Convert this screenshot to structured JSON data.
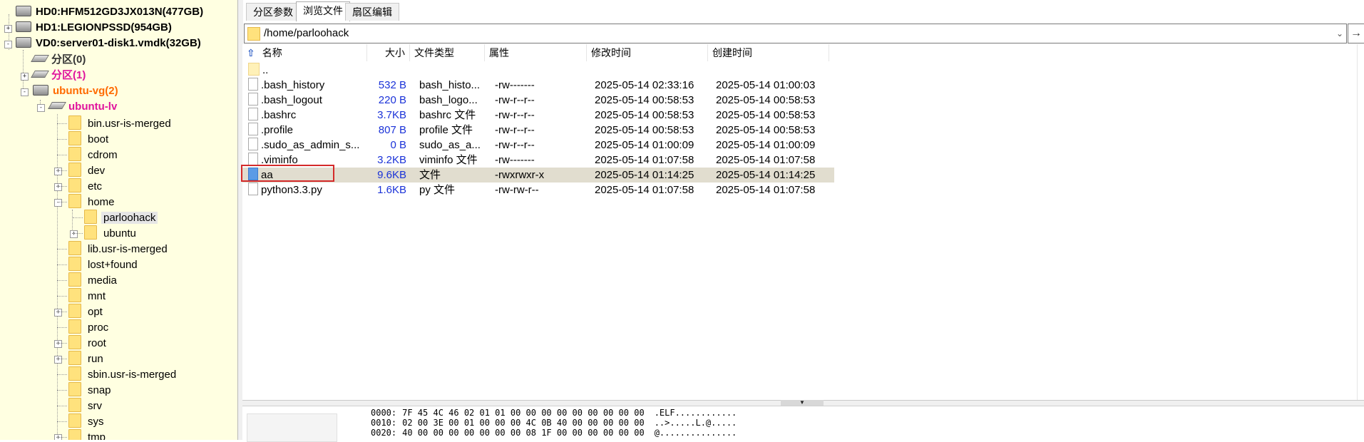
{
  "tree": {
    "disks": [
      {
        "label": "HD0:HFM512GD3JX013N(477GB)"
      },
      {
        "label": "HD1:LEGIONPSSD(954GB)"
      },
      {
        "label": "VD0:server01-disk1.vmdk(32GB)"
      }
    ],
    "partitions": [
      {
        "label": "分区(0)"
      },
      {
        "label": "分区(1)"
      },
      {
        "label": "ubuntu-vg(2)"
      }
    ],
    "lv": {
      "label": "ubuntu-lv"
    },
    "folders": [
      {
        "label": "bin.usr-is-merged",
        "expander": ""
      },
      {
        "label": "boot",
        "expander": ""
      },
      {
        "label": "cdrom",
        "expander": ""
      },
      {
        "label": "dev",
        "expander": "+"
      },
      {
        "label": "etc",
        "expander": "+"
      },
      {
        "label": "home",
        "expander": "-"
      },
      {
        "label": "parloohack",
        "expander": ""
      },
      {
        "label": "ubuntu",
        "expander": "+"
      },
      {
        "label": "lib.usr-is-merged",
        "expander": ""
      },
      {
        "label": "lost+found",
        "expander": ""
      },
      {
        "label": "media",
        "expander": ""
      },
      {
        "label": "mnt",
        "expander": ""
      },
      {
        "label": "opt",
        "expander": "+"
      },
      {
        "label": "proc",
        "expander": ""
      },
      {
        "label": "root",
        "expander": "+"
      },
      {
        "label": "run",
        "expander": "+"
      },
      {
        "label": "sbin.usr-is-merged",
        "expander": ""
      },
      {
        "label": "snap",
        "expander": ""
      },
      {
        "label": "srv",
        "expander": ""
      },
      {
        "label": "sys",
        "expander": ""
      },
      {
        "label": "tmp",
        "expander": "+"
      }
    ]
  },
  "tabs": [
    {
      "label": "分区参数"
    },
    {
      "label": "浏览文件"
    },
    {
      "label": "扇区编辑"
    }
  ],
  "path": {
    "value": "/home/parloohack",
    "go_glyph": "→",
    "drop_glyph": "⌄"
  },
  "columns": {
    "name": "名称",
    "size": "大小",
    "type": "文件类型",
    "attr": "属性",
    "modified": "修改时间",
    "created": "创建时间",
    "up_glyph": "⇧"
  },
  "files": [
    {
      "name": "..",
      "size": "",
      "type": "",
      "attr": "",
      "modified": "",
      "created": ""
    },
    {
      "name": ".bash_history",
      "size": "532 B",
      "type": "bash_histo...",
      "attr": "-rw-------",
      "modified": "2025-05-14 02:33:16",
      "created": "2025-05-14 01:00:03"
    },
    {
      "name": ".bash_logout",
      "size": "220 B",
      "type": "bash_logo...",
      "attr": "-rw-r--r--",
      "modified": "2025-05-14 00:58:53",
      "created": "2025-05-14 00:58:53"
    },
    {
      "name": ".bashrc",
      "size": "3.7KB",
      "type": "bashrc 文件",
      "attr": "-rw-r--r--",
      "modified": "2025-05-14 00:58:53",
      "created": "2025-05-14 00:58:53"
    },
    {
      "name": ".profile",
      "size": "807 B",
      "type": "profile 文件",
      "attr": "-rw-r--r--",
      "modified": "2025-05-14 00:58:53",
      "created": "2025-05-14 00:58:53"
    },
    {
      "name": ".sudo_as_admin_s...",
      "size": "0 B",
      "type": "sudo_as_a...",
      "attr": "-rw-r--r--",
      "modified": "2025-05-14 01:00:09",
      "created": "2025-05-14 01:00:09"
    },
    {
      "name": ".viminfo",
      "size": "3.2KB",
      "type": "viminfo 文件",
      "attr": "-rw-------",
      "modified": "2025-05-14 01:07:58",
      "created": "2025-05-14 01:07:58"
    },
    {
      "name": "aa",
      "size": "9.6KB",
      "type": "文件",
      "attr": "-rwxrwxr-x",
      "modified": "2025-05-14 01:14:25",
      "created": "2025-05-14 01:14:25"
    },
    {
      "name": "python3.3.py",
      "size": "1.6KB",
      "type": "py 文件",
      "attr": "-rw-rw-r--",
      "modified": "2025-05-14 01:07:58",
      "created": "2025-05-14 01:07:58"
    }
  ],
  "hex": [
    {
      "offset": "0000:",
      "bytes": "7F 45 4C 46 02 01 01 00 00 00 00 00 00 00 00 00",
      "ascii": ".ELF............"
    },
    {
      "offset": "0010:",
      "bytes": "02 00 3E 00 01 00 00 00 4C 0B 40 00 00 00 00 00",
      "ascii": "..>.....L.@....."
    },
    {
      "offset": "0020:",
      "bytes": "40 00 00 00 00 00 00 00 08 1F 00 00 00 00 00 00",
      "ascii": "@..............."
    }
  ],
  "colors": {
    "accent_orange": "#ff6a00",
    "accent_magenta": "#e0139d",
    "size_blue": "#1a32d8",
    "tree_bg": "#ffffe1",
    "selection": "#e1ddcf",
    "highlight_red": "#d42a2a"
  }
}
